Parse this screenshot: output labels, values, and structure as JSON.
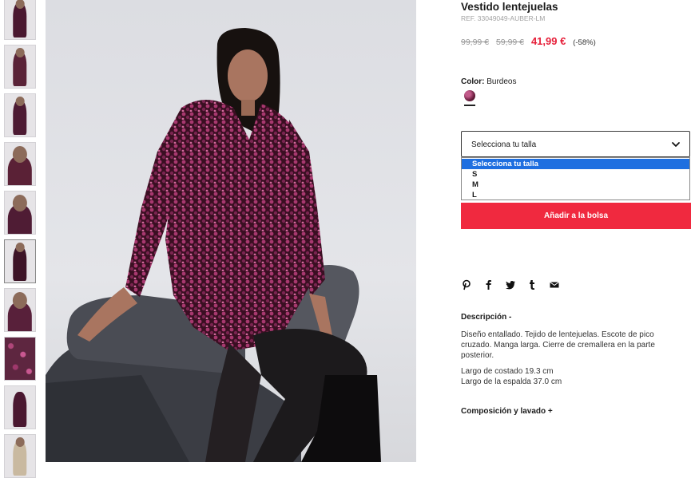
{
  "product": {
    "title": "Vestido lentejuelas",
    "ref": "REF. 33049049-AUBER-LM",
    "price_original": "99,99 €",
    "price_previous": "59,99 €",
    "price_sale": "41,99 €",
    "discount": "(-58%)"
  },
  "color": {
    "label": "Color:",
    "value": "Burdeos"
  },
  "size_select": {
    "label": "Selecciona tu talla",
    "options": [
      "Selecciona tu talla",
      "S",
      "M",
      "L"
    ],
    "selected_index": 0
  },
  "actions": {
    "add_to_bag": "Añadir a la bolsa"
  },
  "share_icons": [
    "pinterest-icon",
    "facebook-icon",
    "twitter-icon",
    "tumblr-icon",
    "email-icon"
  ],
  "description": {
    "title": "Descripción -",
    "text": "Diseño entallado. Tejido de lentejuelas. Escote de pico cruzado. Manga larga. Cierre de cremallera en la parte posterior.",
    "measures": [
      "Largo de costado 19.3 cm",
      "Largo de la espalda 37.0 cm"
    ]
  },
  "composition": {
    "title": "Composición y lavado +"
  },
  "colors": {
    "accent_red": "#f0293f",
    "sale_red": "#e6203a",
    "select_blue": "#1e6fe0"
  }
}
